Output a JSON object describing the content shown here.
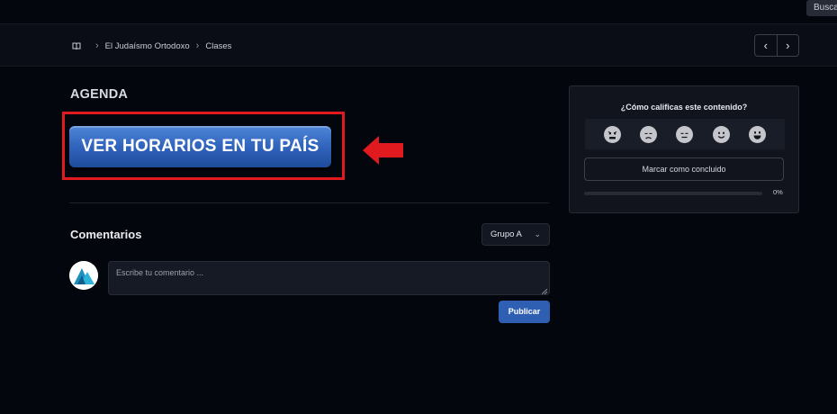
{
  "topbar": {
    "search_label": "Buscar"
  },
  "breadcrumb": {
    "items": [
      "El Judaísmo Ortodoxo",
      "Clases"
    ]
  },
  "pager": {
    "prev_icon": "chevron-left-icon",
    "next_icon": "chevron-right-icon"
  },
  "agenda": {
    "title": "AGENDA",
    "cta_label": "VER HORARIOS EN TU PAÍS",
    "highlight_color": "#e01a1f",
    "button_color": "#3064bd"
  },
  "comments": {
    "title": "Comentarios",
    "group_selected": "Grupo A",
    "placeholder": "Escribe tu comentario ...",
    "publish_label": "Publicar"
  },
  "rating": {
    "question": "¿Cómo calificas este contenido?",
    "faces": [
      "angry-face-icon",
      "sad-face-icon",
      "neutral-face-icon",
      "smile-face-icon",
      "grin-face-icon"
    ],
    "mark_complete_label": "Marcar como concluido",
    "progress_value": 0,
    "progress_label": "0%"
  }
}
